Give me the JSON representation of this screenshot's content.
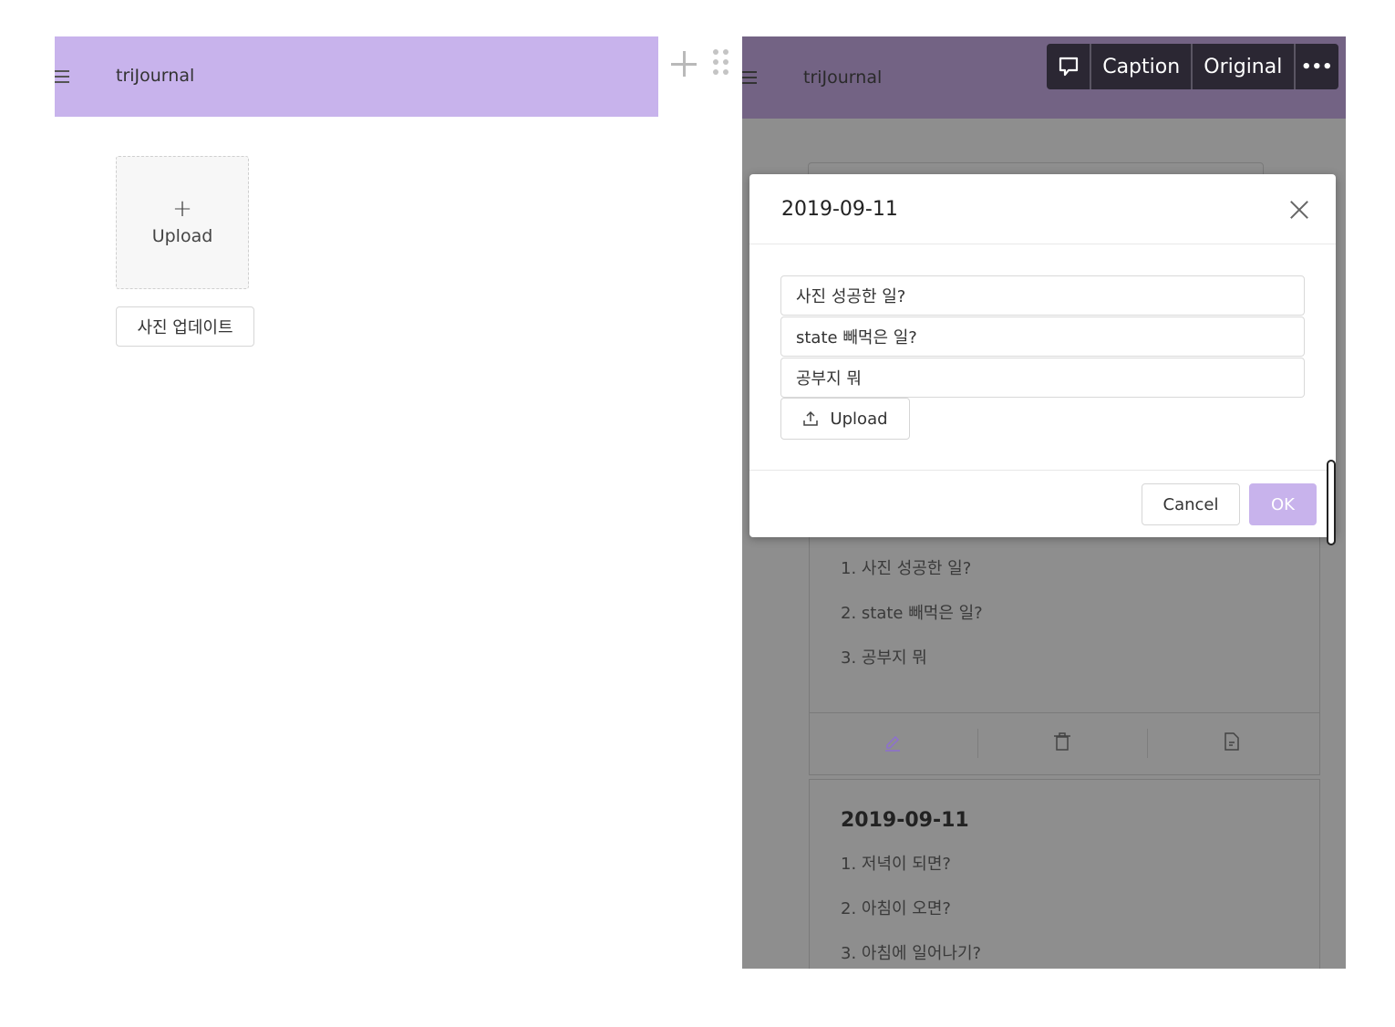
{
  "left": {
    "header": {
      "brand": "triJournal"
    },
    "upload_card": {
      "plus": "+",
      "label": "Upload"
    },
    "photo_update_button": "사진 업데이트"
  },
  "right": {
    "header": {
      "brand": "triJournal"
    },
    "background_cards": [
      {
        "items": [
          "1. 사진 성공한 일?",
          "2. state 빼먹은 일?",
          "3. 공부지 뭐"
        ]
      },
      {
        "date": "2019-09-11",
        "items": [
          "1. 저녁이 되면?",
          "2. 아침이 오면?",
          "3. 아침에 일어나기?"
        ]
      }
    ]
  },
  "modal": {
    "title": "2019-09-11",
    "fields": [
      "사진 성공한 일?",
      "state 빼먹은 일?",
      "공부지 뭐"
    ],
    "upload_label": "Upload",
    "cancel_label": "Cancel",
    "ok_label": "OK"
  },
  "overlay_toolbar": {
    "caption_label": "Caption",
    "original_label": "Original",
    "more_label": "•••"
  },
  "colors": {
    "brand_purple": "#c8b3ec",
    "header_dimmed": "#736384",
    "overlay_bg": "#8e8e8e",
    "toolbar_bg": "#2b2733"
  }
}
